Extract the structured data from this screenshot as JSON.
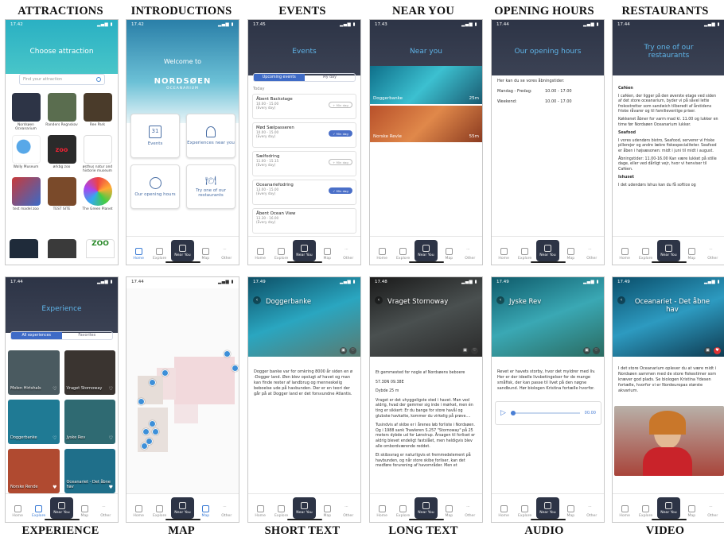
{
  "labels_top": [
    "ATTRACTIONS",
    "INTRODUCTIONS",
    "EVENTS",
    "NEAR YOU",
    "OPENING HOURS",
    "RESTAURANTS"
  ],
  "labels_bottom": [
    "EXPERIENCE",
    "MAP",
    "SHORT TEXT",
    "LONG TEXT",
    "AUDIO",
    "VIDEO"
  ],
  "times": {
    "s1": "17.42",
    "s2": "17.42",
    "s3": "17.45",
    "s4": "17.43",
    "s5": "17.44",
    "s6": "17.44",
    "s7": "17.44",
    "s8": "17.44",
    "s9": "17.49",
    "s10": "17.48",
    "s11": "17.49",
    "s12": "17.49"
  },
  "tabs": [
    "Home",
    "Explore",
    "Near You",
    "Map",
    "Other"
  ],
  "attractions": {
    "title": "Choose attraction",
    "search_placeholder": "Find your attraction",
    "apps": [
      "Nordsøen Oceanarium",
      "Randers Regnskov",
      "Ree Park",
      "Wally Museum",
      "ørkbg zoo",
      "østhus natur and historie museum",
      "test madel zoo",
      "TEST SITE",
      "The Green Planet",
      "",
      "",
      ""
    ],
    "colors": [
      "#2d3446",
      "#5a6d4f",
      "#4a3b2a",
      "#ffffff",
      "#2a2a2a",
      "#ffffff",
      "#c83a3a",
      "#7a4a2a",
      "#ffffff",
      "#1f2b3a",
      "#3a3a3a",
      "#ffffff"
    ]
  },
  "intro": {
    "welcome": "Welcome to",
    "brand": "NORDSØEN",
    "brand_sub": "OCEANARIUM",
    "cards": [
      "Events",
      "Experiences near you",
      "Our opening hours",
      "Try one of our restaurants"
    ]
  },
  "events": {
    "title": "Events",
    "tab_on": "Upcoming events",
    "tab_off": "My day",
    "section": "Today",
    "items": [
      {
        "t": "Åbent Backstage",
        "s": "10.00 - 15.00",
        "d": "(Every day)",
        "b": "+ Min dag",
        "on": false
      },
      {
        "t": "Mød Sælpasseren",
        "s": "10.00 - 15.00",
        "d": "(Every day)",
        "b": "✓ Min dag",
        "on": true
      },
      {
        "t": "Sælfodring",
        "s": "11.00 - 15.15",
        "d": "(Every day)",
        "b": "+ Min dag",
        "on": false
      },
      {
        "t": "Oceanariefodring",
        "s": "13.00 - 15.00",
        "d": "(Every day)",
        "b": "✓ Min dag",
        "on": true
      },
      {
        "t": "Åbent Ocean View",
        "s": "13.30 - 16.00",
        "d": "(Every day)",
        "b": "",
        "on": false
      }
    ]
  },
  "near": {
    "title": "Near you",
    "items": [
      {
        "name": "Doggerbanke",
        "dist": "25m"
      },
      {
        "name": "Norske Revle",
        "dist": "55m"
      }
    ]
  },
  "hours": {
    "title": "Our opening hours",
    "intro": "Her kan du se vores åbningstider:",
    "rows": [
      {
        "d": "Mandag - Fredag:",
        "h": "10.00 - 17.00"
      },
      {
        "d": "Weekend:",
        "h": "10.00 - 17.00"
      }
    ]
  },
  "rest": {
    "title": "Try one of our restaurants",
    "s1": "Caféen",
    "p1": "I caféen, der ligger på den øverste etage ved siden af det store oceanarium, byder vi på såvel lette frokostretter som sandwich tilberedt af årstidens friske råvarer og til familievenlige priser.",
    "p2": "Køkkenet åbner for varm mad kl. 11.00 og lukker en time før Nordsøen Oceanarium lukker.",
    "s2": "Seafood",
    "p3": "I vores udendørs bistro, Seafood, serverer vi friske pillerejer og andre lækre fiskespecialiteter. Seafood er åben i højsæsonen: midt i juni til midt i august.",
    "p4": "Åbningstider: 11.00-16.00 Kan være lukket på stille dage, eller ved dårligt vejr, hvor vi henviser til Caféen.",
    "s3": "Ishuset",
    "p5": "I det udendørs Ishus kan du få softice og"
  },
  "exp": {
    "title": "Experience",
    "tab_on": "All experiences",
    "tab_off": "Favorites",
    "items": [
      {
        "n": "Molen Hirtshals",
        "c": "#4a5a60"
      },
      {
        "n": "Vraget Stornoway",
        "c": "#3a3430"
      },
      {
        "n": "Doggerbanke",
        "c": "#1f7a94"
      },
      {
        "n": "Jyske Rev",
        "c": "#2f6a72"
      },
      {
        "n": "Norske Rende",
        "c": "#b04a30"
      },
      {
        "n": "Oceanariet - Det åbne hav",
        "c": "#1f6f8a"
      }
    ]
  },
  "short": {
    "title": "Doggerbanke",
    "body": "Dogger banke var for omkring 8000 år siden en ø -Dogger land. Øen blev opslugt af havet og man kan finde rester af landbrug og menneskelig beboelse ude på havbunden. Der er en teori der går på at Dogger land er det forsvundne Atlantis."
  },
  "long": {
    "title": "Vraget Stornoway",
    "l1": "Et gemmested for nogle af Nordsøens beboere",
    "l2": "57.30N 09.38E",
    "l3": "Dybde 25 m",
    "p1": "Vraget er det uhyggeligste sted i havet. Man ved aldrig, hvad der gemmer sig inde i mørket, men én ting er sikkert: Er du bange for store havål og glubske havkatte, kommer du virkelig på prøve....",
    "p2": "Tusindvis af skibe er i årenes løb forliste i Nordsøen. Og i 1988 sank Trawleren S.257 \"Stornoway\" på 25 meters dybde ud for Lønstrup. Årsagen til forliset er aldrig blevet endeligt fastslået, men heldigvis blev alle ombordværende reddet.",
    "p3": "Et skibsvrag er naturligvis et fremmedelement på havbunden, og når store skibe forliser, kan det medføre forurening af havområder. Men et"
  },
  "audio": {
    "title": "Jyske Rev",
    "body": "Revet er havets storby, hvor det myldrer med liv. Her er der ideelle livsbetingelser for de mange småfisk, der kan passe til livet på den nøgne sandbund. Hør biologen Kristina fortælle hvorfor.",
    "time": "00.00"
  },
  "video": {
    "title": "Oceanariet - Det åbne hav",
    "body": "I det store Oceanarium oplever du at være midt i Nordsøen sammen med de store fiskestimer som kræver god plads. Se biologen Kristina Ydesen fortælle, hvorfor vi er Nordeuropas største akvarium."
  }
}
